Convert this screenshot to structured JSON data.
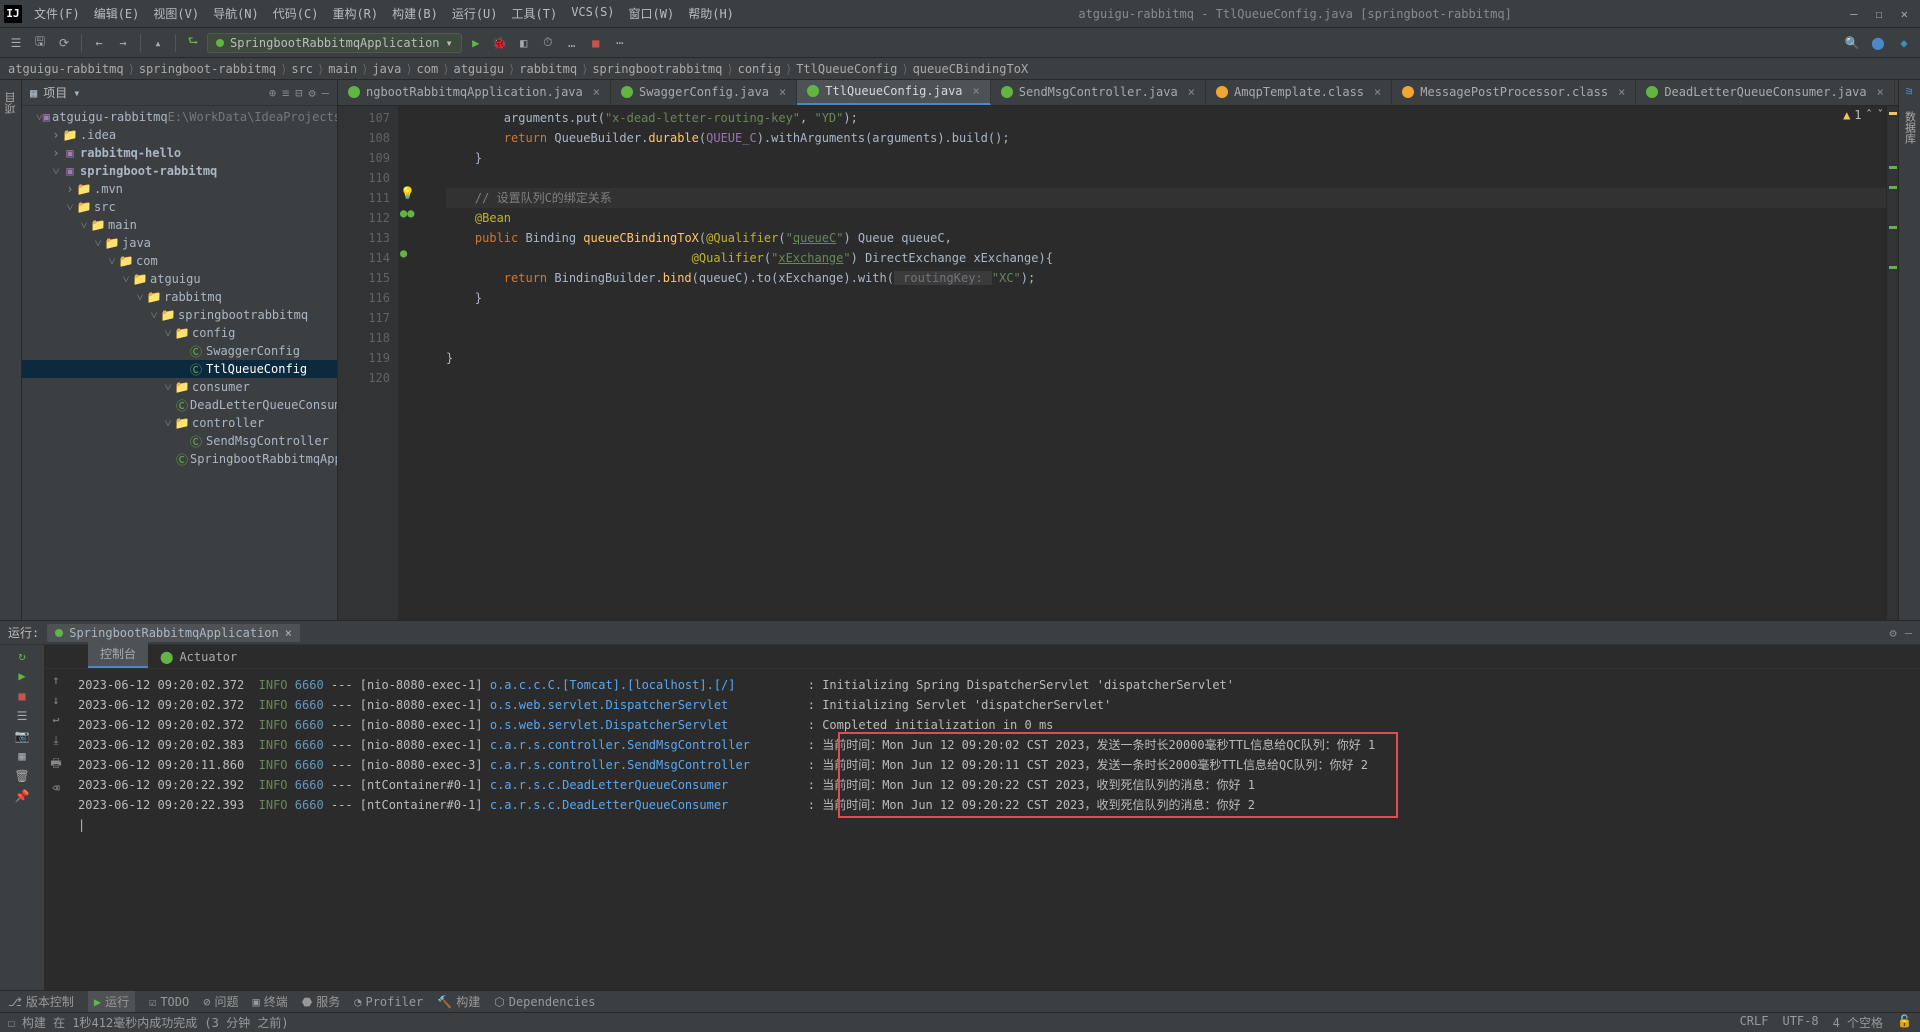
{
  "title": "atguigu-rabbitmq - TtlQueueConfig.java [springboot-rabbitmq]",
  "menu": [
    "文件(F)",
    "编辑(E)",
    "视图(V)",
    "导航(N)",
    "代码(C)",
    "重构(R)",
    "构建(B)",
    "运行(U)",
    "工具(T)",
    "VCS(S)",
    "窗口(W)",
    "帮助(H)"
  ],
  "run_config": "SpringbootRabbitmqApplication",
  "breadcrumbs": [
    "atguigu-rabbitmq",
    "springboot-rabbitmq",
    "src",
    "main",
    "java",
    "com",
    "atguigu",
    "rabbitmq",
    "springbootrabbitmq",
    "config",
    "TtlQueueConfig",
    "queueCBindingToX"
  ],
  "project_label": "项目",
  "project_root": {
    "name": "atguigu-rabbitmq",
    "path": "E:\\WorkData\\IdeaProjects\\RabbitMQ\\a"
  },
  "tree": [
    {
      "d": 1,
      "open": true,
      "ico": "mod",
      "txt": "atguigu-rabbitmq",
      "extra": "E:\\WorkData\\IdeaProjects\\RabbitMQ\\a"
    },
    {
      "d": 2,
      "open": false,
      "ico": "folder",
      "txt": ".idea"
    },
    {
      "d": 2,
      "open": false,
      "ico": "mod",
      "txt": "rabbitmq-hello",
      "bold": true
    },
    {
      "d": 2,
      "open": true,
      "ico": "mod",
      "txt": "springboot-rabbitmq",
      "bold": true
    },
    {
      "d": 3,
      "open": false,
      "ico": "folder",
      "txt": ".mvn"
    },
    {
      "d": 3,
      "open": true,
      "ico": "folder",
      "txt": "src"
    },
    {
      "d": 4,
      "open": true,
      "ico": "folder",
      "txt": "main"
    },
    {
      "d": 5,
      "open": true,
      "ico": "folder",
      "txt": "java"
    },
    {
      "d": 6,
      "open": true,
      "ico": "folder",
      "txt": "com"
    },
    {
      "d": 7,
      "open": true,
      "ico": "folder",
      "txt": "atguigu"
    },
    {
      "d": 8,
      "open": true,
      "ico": "folder",
      "txt": "rabbitmq"
    },
    {
      "d": 9,
      "open": true,
      "ico": "folder",
      "txt": "springbootrabbitmq"
    },
    {
      "d": 10,
      "open": true,
      "ico": "folder",
      "txt": "config"
    },
    {
      "d": 11,
      "ico": "class",
      "txt": "SwaggerConfig"
    },
    {
      "d": 11,
      "ico": "class",
      "txt": "TtlQueueConfig",
      "sel": true
    },
    {
      "d": 10,
      "open": true,
      "ico": "folder",
      "txt": "consumer"
    },
    {
      "d": 11,
      "ico": "class",
      "txt": "DeadLetterQueueConsumer"
    },
    {
      "d": 10,
      "open": true,
      "ico": "folder",
      "txt": "controller"
    },
    {
      "d": 11,
      "ico": "class",
      "txt": "SendMsgController"
    },
    {
      "d": 11,
      "ico": "class",
      "txt": "SpringbootRabbitmqApplication"
    }
  ],
  "tabs": [
    {
      "label": "ngbootRabbitmqApplication.java",
      "ico": "g"
    },
    {
      "label": "SwaggerConfig.java",
      "ico": "g"
    },
    {
      "label": "TtlQueueConfig.java",
      "ico": "g",
      "active": true
    },
    {
      "label": "SendMsgController.java",
      "ico": "g"
    },
    {
      "label": "AmqpTemplate.class",
      "ico": "o"
    },
    {
      "label": "MessagePostProcessor.class",
      "ico": "o"
    },
    {
      "label": "DeadLetterQueueConsumer.java",
      "ico": "g"
    }
  ],
  "warnings": "1",
  "code_start": 107,
  "code": [
    {
      "n": 107,
      "html": "        arguments.put(<span class='str'>\"x-dead-letter-routing-key\"</span>, <span class='str'>\"YD\"</span>);"
    },
    {
      "n": 108,
      "html": "        <span class='kw'>return</span> QueueBuilder.<span class='fn'>durable</span>(<span class='id2'>QUEUE_C</span>).withArguments(arguments).build();"
    },
    {
      "n": 109,
      "html": "    }"
    },
    {
      "n": 110,
      "html": ""
    },
    {
      "n": 111,
      "html": "    <span class='cm'>// 设置队列C的绑定关系</span>",
      "hl": true
    },
    {
      "n": 112,
      "html": "    <span class='ann'>@Bean</span>",
      "gut": "bean"
    },
    {
      "n": 113,
      "html": "    <span class='kw'>public</span> Binding <span class='fn'>queueCBindingToX</span>(<span class='ann'>@Qualifier</span>(<span class='str'>\"<u>queueC</u>\"</span>) Queue queueC,"
    },
    {
      "n": 114,
      "html": "                                  <span class='ann'>@Qualifier</span>(<span class='str'>\"<u>xExchange</u>\"</span>) DirectExchange xExchange){",
      "gut": "bean2"
    },
    {
      "n": 115,
      "html": "        <span class='kw'>return</span> BindingBuilder.<span class='fn'>bind</span>(queueC).to(xExchange).with(<span class='param'> routingKey: </span><span class='str'>\"XC\"</span>);"
    },
    {
      "n": 116,
      "html": "    }"
    },
    {
      "n": 117,
      "html": ""
    },
    {
      "n": 118,
      "html": ""
    },
    {
      "n": 119,
      "html": "}"
    },
    {
      "n": 120,
      "html": ""
    }
  ],
  "run_panel": {
    "label": "运行:",
    "tab": "SpringbootRabbitmqApplication",
    "subtabs": [
      "控制台",
      "Actuator"
    ]
  },
  "log": [
    {
      "ts": "2023-06-12 09:20:02.372",
      "lvl": "INFO",
      "pid": "6660",
      "thr": "[nio-8080-exec-1]",
      "logger": "o.a.c.c.C.[Tomcat].[localhost].[/]",
      "msg": ": Initializing Spring DispatcherServlet 'dispatcherServlet'"
    },
    {
      "ts": "2023-06-12 09:20:02.372",
      "lvl": "INFO",
      "pid": "6660",
      "thr": "[nio-8080-exec-1]",
      "logger": "o.s.web.servlet.DispatcherServlet",
      "msg": ": Initializing Servlet 'dispatcherServlet'"
    },
    {
      "ts": "2023-06-12 09:20:02.372",
      "lvl": "INFO",
      "pid": "6660",
      "thr": "[nio-8080-exec-1]",
      "logger": "o.s.web.servlet.DispatcherServlet",
      "msg": ": Completed initialization in 0 ms"
    },
    {
      "ts": "2023-06-12 09:20:02.383",
      "lvl": "INFO",
      "pid": "6660",
      "thr": "[nio-8080-exec-1]",
      "logger": "c.a.r.s.controller.SendMsgController",
      "msg": ": 当前时间：Mon Jun 12 09:20:02 CST 2023，发送一条时长20000毫秒TTL信息给QC队列：你好 1",
      "box": true
    },
    {
      "ts": "2023-06-12 09:20:11.860",
      "lvl": "INFO",
      "pid": "6660",
      "thr": "[nio-8080-exec-3]",
      "logger": "c.a.r.s.controller.SendMsgController",
      "msg": ": 当前时间：Mon Jun 12 09:20:11 CST 2023，发送一条时长2000毫秒TTL信息给QC队列：你好 2",
      "box": true
    },
    {
      "ts": "2023-06-12 09:20:22.392",
      "lvl": "INFO",
      "pid": "6660",
      "thr": "[ntContainer#0-1]",
      "logger": "c.a.r.s.c.DeadLetterQueueConsumer",
      "msg": ": 当前时间：Mon Jun 12 09:20:22 CST 2023，收到死信队列的消息：你好 1",
      "box": true
    },
    {
      "ts": "2023-06-12 09:20:22.393",
      "lvl": "INFO",
      "pid": "6660",
      "thr": "[ntContainer#0-1]",
      "logger": "c.a.r.s.c.DeadLetterQueueConsumer",
      "msg": ": 当前时间：Mon Jun 12 09:20:22 CST 2023，收到死信队列的消息：你好 2",
      "box": true
    }
  ],
  "status": {
    "items": [
      "版本控制",
      "运行",
      "TODO",
      "问题",
      "终端",
      "服务",
      "Profiler",
      "构建",
      "Dependencies"
    ],
    "build": "构建 在 1秒412毫秒内成功完成 (3 分钟 之前)",
    "right": [
      "CRLF",
      "UTF-8",
      "4 个空格"
    ]
  }
}
